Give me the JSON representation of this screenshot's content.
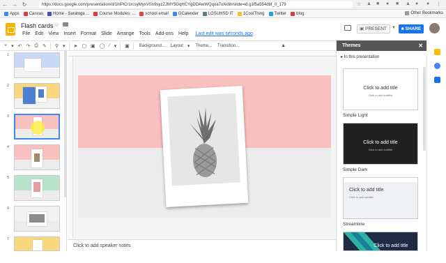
{
  "browser": {
    "url": "https://docs.google.com/presentation/d/1hlPlCr1rcsyMyxVSn9syzZJMY5GqHCYgDDAwWQqoa7o/edit#slide=id.g1f5a554dbf_0_179",
    "bookmarks": [
      {
        "label": "Apps",
        "color": "#4285f4"
      },
      {
        "label": "Canvas",
        "color": "#e53935"
      },
      {
        "label": "Home - Saratoga ...",
        "color": "#3f51b5"
      },
      {
        "label": "Course Modules: ...",
        "color": "#e53935"
      },
      {
        "label": "school email",
        "color": "#ea4335"
      },
      {
        "label": "GCalender",
        "color": "#4285f4"
      },
      {
        "label": "LGSUHSD IT",
        "color": "#607d8b"
      },
      {
        "label": "1CoolThing",
        "color": "#fbc02d"
      },
      {
        "label": "Twitter",
        "color": "#1da1f2"
      },
      {
        "label": "blog",
        "color": "#e53935"
      }
    ],
    "other_bookmarks": "Other Bookmarks"
  },
  "doc": {
    "title": "Flash cards",
    "menu": [
      "File",
      "Edit",
      "View",
      "Insert",
      "Format",
      "Slide",
      "Arrange",
      "Tools",
      "Add-ons",
      "Help"
    ],
    "last_edit": "Last edit was seconds ago",
    "present_label": "PRESENT",
    "share_label": "SHARE"
  },
  "toolbar": {
    "background": "Background...",
    "layout": "Layout",
    "theme": "Theme...",
    "transition": "Transition..."
  },
  "filmstrip": {
    "slides": [
      "1",
      "2",
      "3",
      "4",
      "5",
      "6",
      "7"
    ]
  },
  "notes": {
    "placeholder": "Click to add speaker notes"
  },
  "themes_panel": {
    "title": "Themes",
    "section": "In this presentation",
    "themes": [
      {
        "name": "Simple Light",
        "title": "Click to add title",
        "subtitle": "Click to add subtitle"
      },
      {
        "name": "Simple Dark",
        "title": "Click to add title",
        "subtitle": "Click to add subtitle"
      },
      {
        "name": "Streamline",
        "title": "Click to add title",
        "subtitle": "Click to add subtitle"
      },
      {
        "name": "",
        "title": "Click to add title",
        "subtitle": ""
      }
    ]
  },
  "colors": {
    "accent": "#1a73e8",
    "slide_pink": "#f8c0bf",
    "slide_gray": "#ececec",
    "logo_yellow": "#f4b400"
  }
}
